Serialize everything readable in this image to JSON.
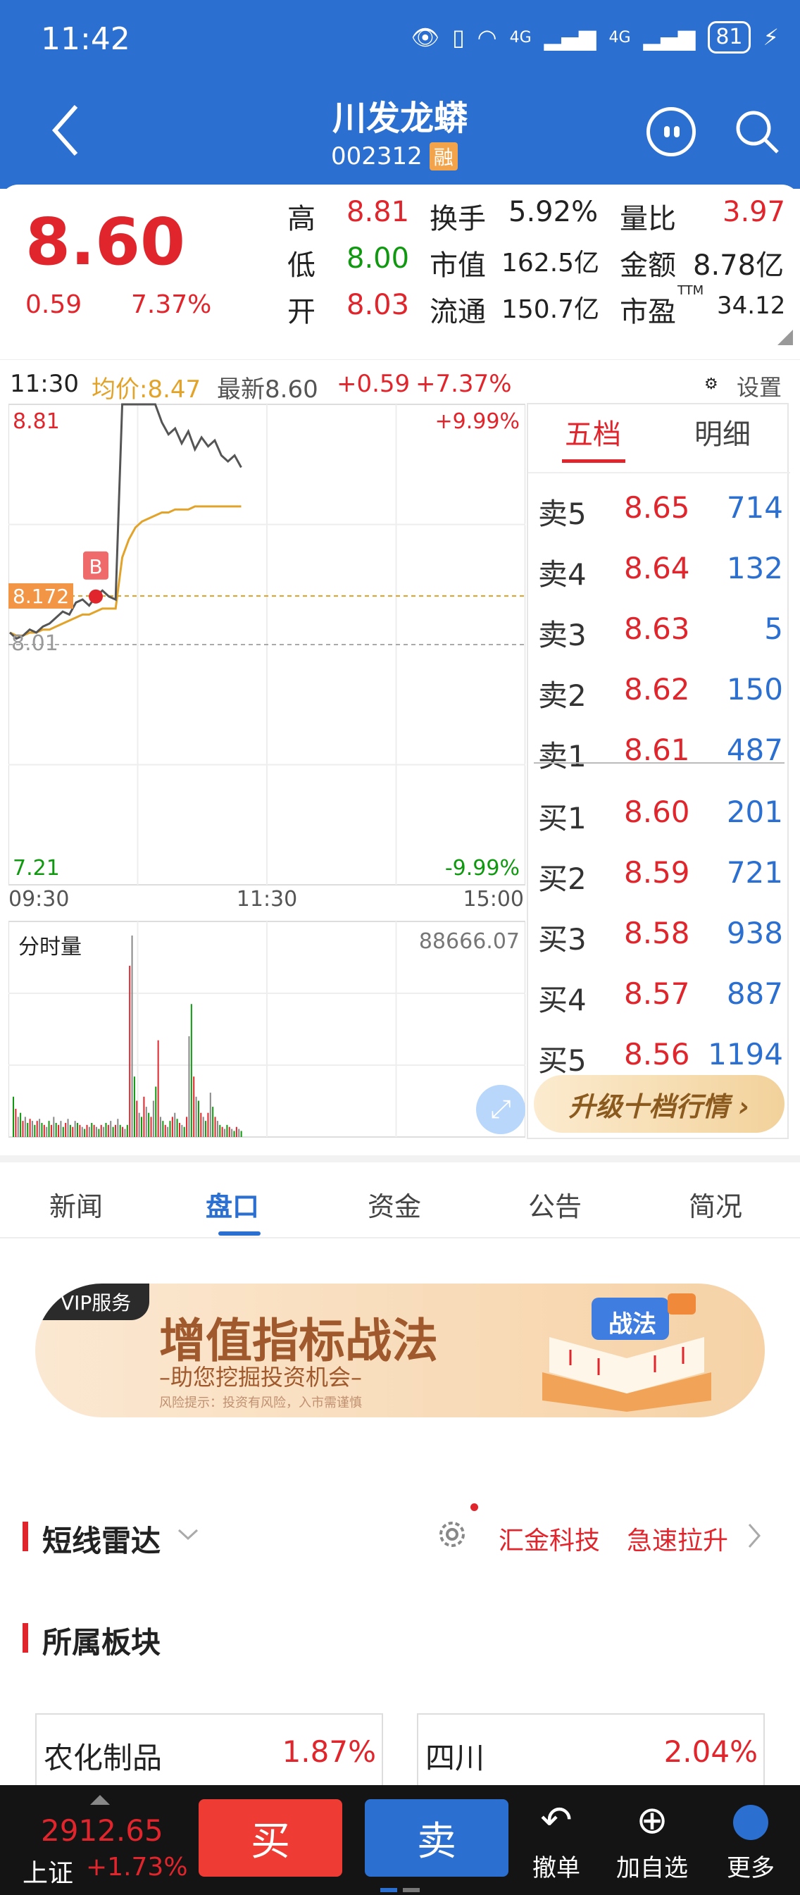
{
  "status": {
    "time": "11:42",
    "battery": "81",
    "signal1": "4G",
    "signal2": "4G"
  },
  "header": {
    "title": "川发龙蟒",
    "code": "002312",
    "badge": "融"
  },
  "quote": {
    "price": "8.60",
    "change": "0.59",
    "change_pct": "7.37%",
    "high_label": "高",
    "high": "8.81",
    "low_label": "低",
    "low": "8.00",
    "open_label": "开",
    "open": "8.03",
    "turnover_label": "换手",
    "turnover": "5.92%",
    "mcap_label": "市值",
    "mcap": "162.5亿",
    "float_label": "流通",
    "float": "150.7亿",
    "volratio_label": "量比",
    "volratio": "3.97",
    "amount_label": "金额",
    "amount": "8.78亿",
    "pe_label": "市盈",
    "pe_sup": "TTM",
    "pe": "34.12"
  },
  "chartbar": {
    "time": "11:30",
    "avg": "均价:8.47",
    "latest": "最新8.60",
    "chg": "+0.59",
    "chg_pct": "+7.37%",
    "settings": "设置"
  },
  "chart_data": {
    "type": "line",
    "price_axis": {
      "top": "8.81",
      "bottom": "7.21",
      "top_pct": "+9.99%",
      "bottom_pct": "-9.99%",
      "prev_close": "8.01",
      "marker": "8.172"
    },
    "x_ticks": [
      "09:30",
      "11:30",
      "15:00"
    ],
    "buy_marker": "B",
    "volume_label": "分时量",
    "volume_max": "88666.07",
    "price_series": [
      8.05,
      8.03,
      8.04,
      8.06,
      8.05,
      8.07,
      8.08,
      8.1,
      8.12,
      8.11,
      8.15,
      8.16,
      8.14,
      8.17,
      8.19,
      8.17,
      8.16,
      8.81,
      8.81,
      8.81,
      8.81,
      8.81,
      8.81,
      8.75,
      8.71,
      8.73,
      8.68,
      8.72,
      8.66,
      8.7,
      8.67,
      8.69,
      8.64,
      8.62,
      8.64,
      8.6
    ],
    "avg_series": [
      8.05,
      8.04,
      8.04,
      8.05,
      8.05,
      8.06,
      8.06,
      8.07,
      8.08,
      8.09,
      8.1,
      8.11,
      8.11,
      8.12,
      8.13,
      8.13,
      8.13,
      8.3,
      8.36,
      8.4,
      8.42,
      8.43,
      8.44,
      8.45,
      8.45,
      8.46,
      8.46,
      8.46,
      8.47,
      8.47,
      8.47,
      8.47,
      8.47,
      8.47,
      8.47,
      8.47
    ],
    "volume_series": [
      20,
      14,
      10,
      12,
      8,
      10,
      7,
      9,
      8,
      6,
      8,
      9,
      7,
      6,
      5,
      8,
      6,
      10,
      7,
      6,
      8,
      5,
      7,
      9,
      6,
      5,
      8,
      7,
      6,
      5,
      4,
      6,
      5,
      7,
      6,
      5,
      4,
      6,
      5,
      7,
      6,
      8,
      5,
      6,
      9,
      6,
      5,
      4,
      6,
      85,
      100,
      30,
      18,
      12,
      10,
      20,
      15,
      12,
      10,
      18,
      25,
      48,
      10,
      8,
      6,
      5,
      8,
      10,
      12,
      9,
      7,
      6,
      5,
      10,
      50,
      66,
      30,
      20,
      18,
      12,
      10,
      8,
      12,
      22,
      15,
      10,
      8,
      6,
      5,
      4,
      6,
      5,
      4,
      3,
      5,
      4,
      3
    ]
  },
  "book": {
    "tab_five": "五档",
    "tab_detail": "明细",
    "asks": [
      {
        "l": "卖5",
        "p": "8.65",
        "v": "714"
      },
      {
        "l": "卖4",
        "p": "8.64",
        "v": "132"
      },
      {
        "l": "卖3",
        "p": "8.63",
        "v": "5"
      },
      {
        "l": "卖2",
        "p": "8.62",
        "v": "150"
      },
      {
        "l": "卖1",
        "p": "8.61",
        "v": "487"
      }
    ],
    "bids": [
      {
        "l": "买1",
        "p": "8.60",
        "v": "201"
      },
      {
        "l": "买2",
        "p": "8.59",
        "v": "721"
      },
      {
        "l": "买3",
        "p": "8.58",
        "v": "938"
      },
      {
        "l": "买4",
        "p": "8.57",
        "v": "887"
      },
      {
        "l": "买5",
        "p": "8.56",
        "v": "1194"
      }
    ],
    "upgrade": "升级十档行情 ›"
  },
  "tabs": [
    "新闻",
    "盘口",
    "资金",
    "公告",
    "简况"
  ],
  "banner": {
    "vip": "VIP服务",
    "title": "增值指标战法",
    "sub": "–助您挖掘投资机会–",
    "risk": "风险提示：投资有风险，入市需谨慎",
    "book_label": "战法"
  },
  "radar": {
    "title": "短线雷达",
    "link1": "汇金科技",
    "link2": "急速拉升"
  },
  "sectors": {
    "title": "所属板块",
    "items": [
      {
        "name": "农化制品",
        "pct": "1.87%"
      },
      {
        "name": "四川",
        "pct": "2.04%"
      }
    ]
  },
  "bottom": {
    "index_val": "2912.65",
    "index_name": "上证",
    "index_chg": "+1.73%",
    "buy": "买",
    "sell": "卖",
    "cancel": "撤单",
    "add": "加自选",
    "more": "更多"
  },
  "colors": {
    "red": "#e0262c",
    "blue": "#2b6fd0",
    "green": "#109910",
    "avg": "#e2a32a"
  }
}
